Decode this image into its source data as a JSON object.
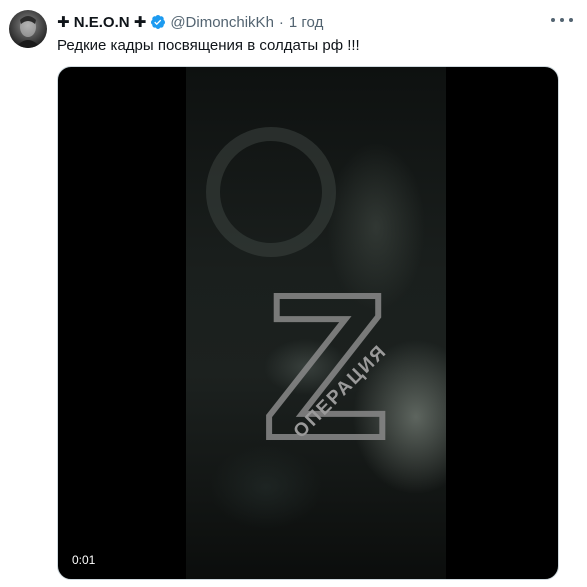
{
  "tweet": {
    "display_name": "✚ N.E.O.N ✚",
    "handle": "@DimonchikKh",
    "separator": "·",
    "time": "1 год",
    "text": "Редкие кадры посвящения в солдаты рф !!!",
    "verified": true,
    "verified_color": "#1d9bf0"
  },
  "media": {
    "type": "video",
    "duration": "0:01",
    "watermark_letter": "Z",
    "watermark_text": "ОПЕРАЦИЯ"
  },
  "icons": [
    "avatar",
    "verified-badge-icon",
    "more-options-icon"
  ]
}
